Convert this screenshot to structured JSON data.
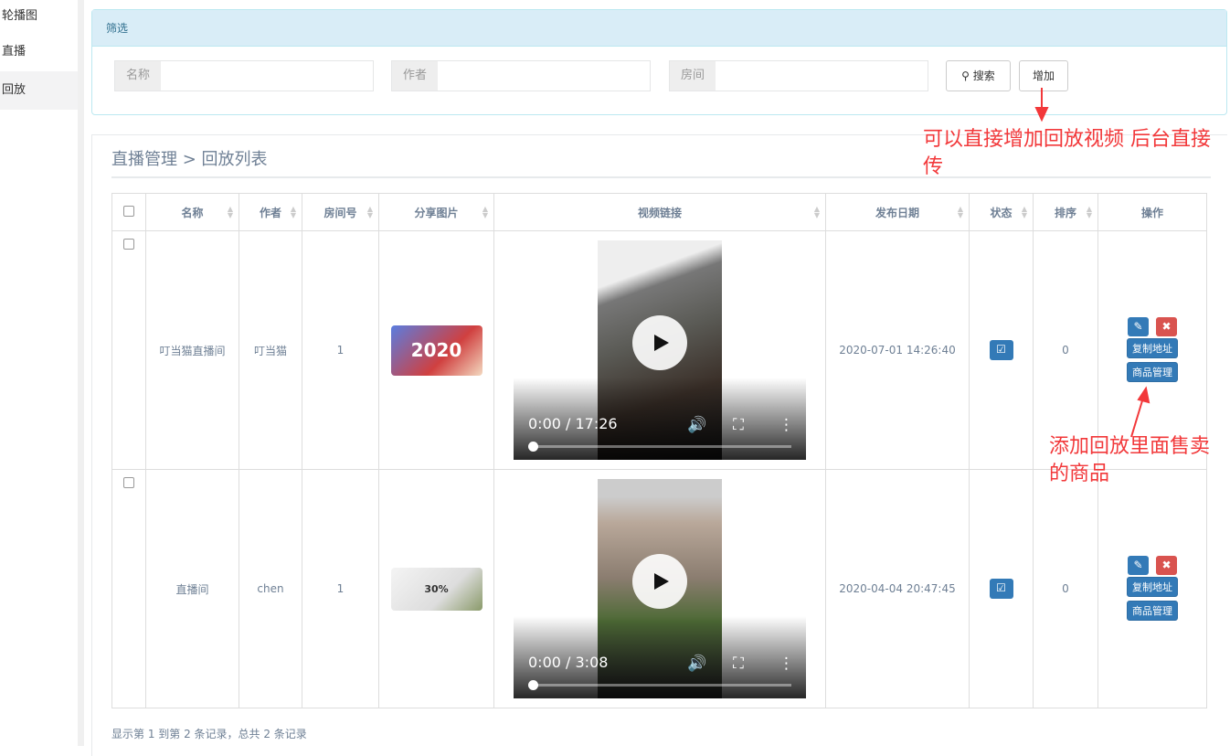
{
  "sidebar": {
    "items": [
      {
        "label": "轮播图"
      },
      {
        "label": "直播"
      },
      {
        "label": "回放"
      }
    ]
  },
  "filter": {
    "title": "筛选",
    "fields": [
      {
        "label": "名称",
        "value": ""
      },
      {
        "label": "作者",
        "value": ""
      },
      {
        "label": "房间",
        "value": ""
      }
    ],
    "search_label": "搜索",
    "add_label": "增加"
  },
  "list": {
    "breadcrumb": "直播管理 > 回放列表",
    "columns": [
      "名称",
      "作者",
      "房间号",
      "分享图片",
      "视频链接",
      "发布日期",
      "状态",
      "排序",
      "操作"
    ],
    "rows": [
      {
        "name": "叮当猫直播间",
        "author": "叮当猫",
        "room": "1",
        "image_text": "2020",
        "video_time": "0:00 / 17:26",
        "date": "2020-07-01 14:26:40",
        "order": "0",
        "copy": "复制地址",
        "goods": "商品管理"
      },
      {
        "name": "直播间",
        "author": "chen",
        "room": "1",
        "image_text": "30%",
        "video_time": "0:00 / 3:08",
        "date": "2020-04-04 20:47:45",
        "order": "0",
        "copy": "复制地址",
        "goods": "商品管理"
      }
    ],
    "footer": "显示第 1 到第 2 条记录，总共 2 条记录"
  },
  "annotations": {
    "add_note": "可以直接增加回放视频 后台直接传",
    "goods_note": "添加回放里面售卖的商品"
  },
  "colors": {
    "primary": "#337ab7",
    "danger": "#d9534f",
    "annotation": "#f2383a",
    "panel_header": "#d9edf7"
  }
}
